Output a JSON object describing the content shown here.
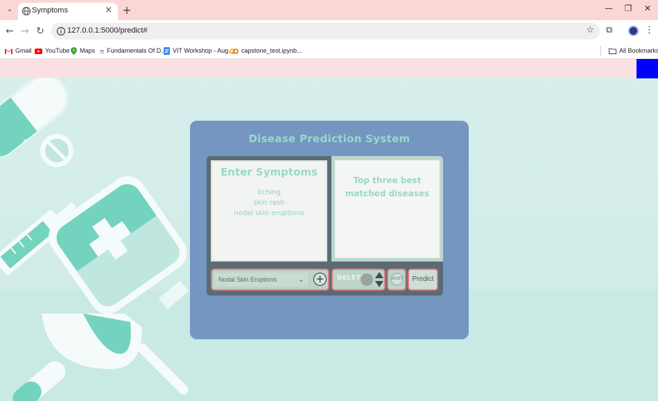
{
  "browser": {
    "tab": {
      "title": "Symptoms"
    },
    "url": "127.0.0.1:5000/predict#",
    "bookmarks": [
      {
        "label": "Gmail",
        "icon": "gmail-icon"
      },
      {
        "label": "YouTube",
        "icon": "youtube-icon"
      },
      {
        "label": "Maps",
        "icon": "maps-icon"
      },
      {
        "label": "Fundamentals Of D...",
        "icon": "pi-icon"
      },
      {
        "label": "VIT Workshop - Aug...",
        "icon": "docs-icon"
      },
      {
        "label": "capstone_test.ipynb...",
        "icon": "colab-icon"
      }
    ],
    "all_bookmarks": "All Bookmarks"
  },
  "app": {
    "title": "Disease Prediction System",
    "enter_title": "Enter Symptoms",
    "symptoms": [
      "itching",
      "skin rash",
      "nodal skin eruptions"
    ],
    "results_title": "Top three best matched diseases",
    "select_value": "Nodal Skin Eruptions",
    "delete_label": "DELETE",
    "reset_label": "RESET",
    "predict_label": "Predict"
  },
  "colors": {
    "card": "#7496c0",
    "accent_text": "#9ad9c5",
    "control_border": "#e2787f",
    "tabstrip": "#fcd6d6",
    "corner_box": "#0000ff"
  }
}
